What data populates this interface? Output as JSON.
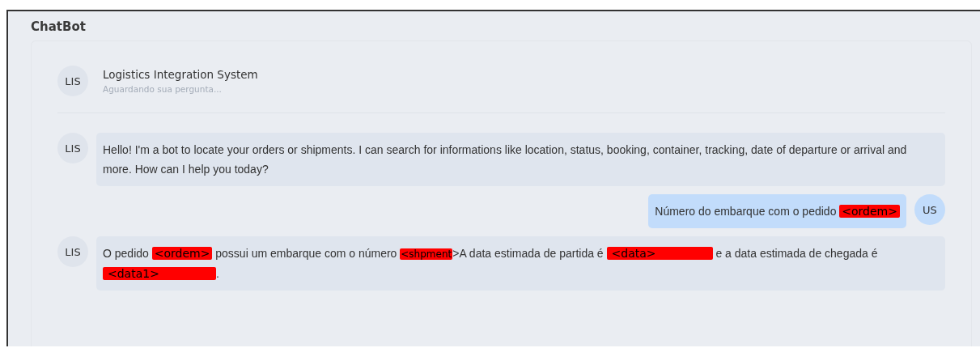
{
  "title": "ChatBot",
  "header": {
    "avatar": "LIS",
    "name": "Logistics Integration System",
    "status": "Aguardando sua pergunta..."
  },
  "messages": [
    {
      "kind": "bot",
      "avatar": "LIS",
      "parts": [
        {
          "kind": "text",
          "text": "Hello! I'm a bot to locate your orders or shipments. I can search for informations like location, status, booking, container, tracking, date of departure or arrival and more. How can I help you today?"
        }
      ]
    },
    {
      "kind": "user",
      "avatar": "US",
      "parts": [
        {
          "kind": "text",
          "text": "Número do embarque com o pedido "
        },
        {
          "kind": "tag",
          "text": "<ordem>"
        }
      ]
    },
    {
      "kind": "bot",
      "avatar": "LIS",
      "parts": [
        {
          "kind": "text",
          "text": "O pedido "
        },
        {
          "kind": "tag",
          "text": "<ordem>"
        },
        {
          "kind": "text",
          "text": " possui um embarque com o número "
        },
        {
          "kind": "small-tag",
          "text": "<shpment"
        },
        {
          "kind": "text",
          "text": ">A data estimada de partida é "
        },
        {
          "kind": "long-tag",
          "text": "<data>"
        },
        {
          "kind": "text",
          "text": " e a data estimada de chegada é "
        },
        {
          "kind": "long-tag",
          "text": "<data1>"
        },
        {
          "kind": "text",
          "text": "."
        }
      ]
    }
  ]
}
